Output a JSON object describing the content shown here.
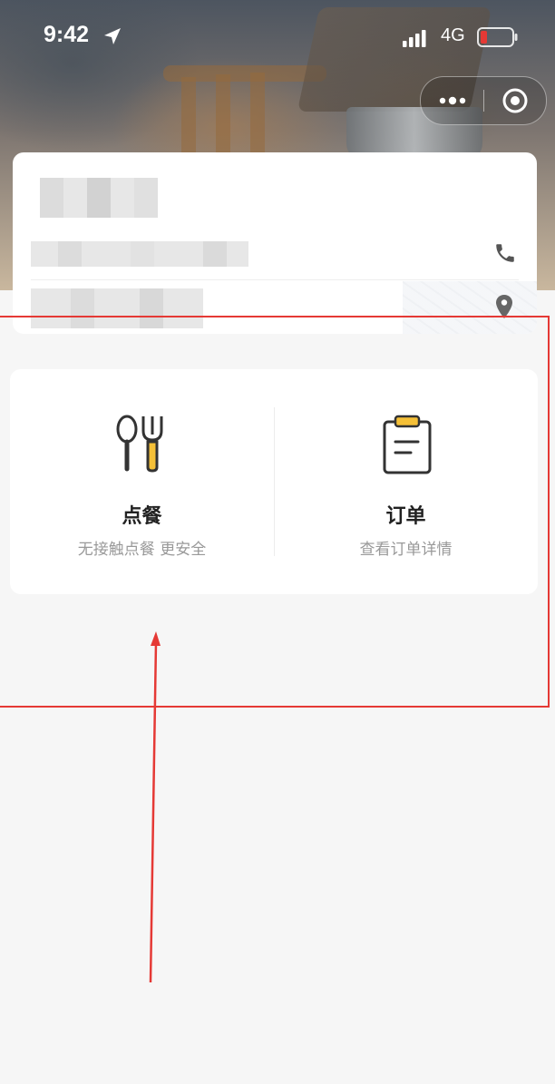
{
  "status_bar": {
    "time": "9:42",
    "network": "4G",
    "battery_color": "#e53935"
  },
  "capsule": {
    "more_icon": "more-icon",
    "close_icon": "target-icon"
  },
  "store_info": {
    "name": "",
    "phone": "",
    "address": ""
  },
  "actions": [
    {
      "title": "点餐",
      "subtitle": "无接触点餐 更安全",
      "icon": "spoon-fork-icon"
    },
    {
      "title": "订单",
      "subtitle": "查看订单详情",
      "icon": "clipboard-icon"
    }
  ],
  "colors": {
    "accent": "#f5c037",
    "annotation": "#e53935",
    "background": "#f6f6f6"
  }
}
